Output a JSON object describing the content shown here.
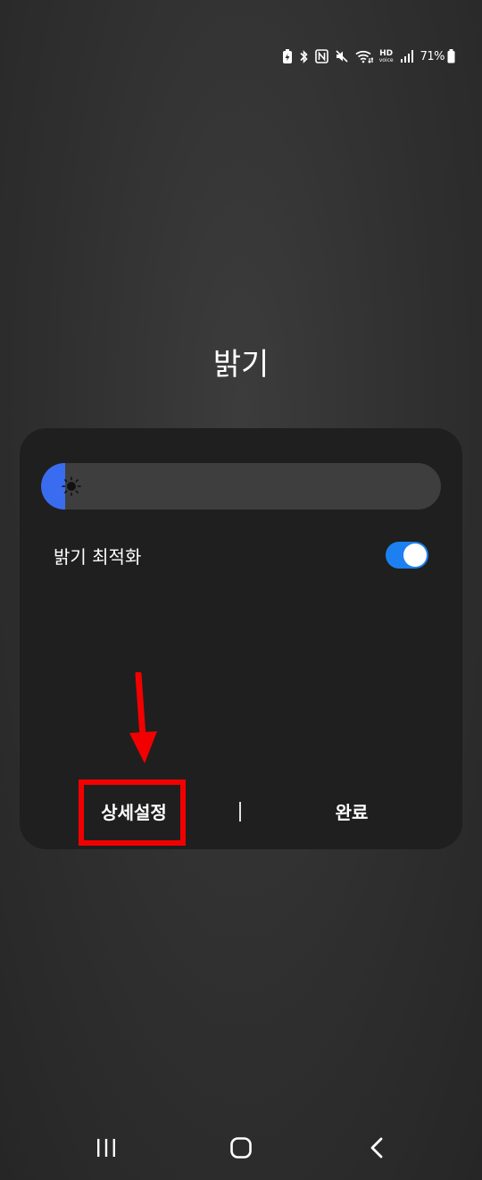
{
  "status_bar": {
    "battery_percent": "71%",
    "icons": [
      "battery-saver-icon",
      "bluetooth-icon",
      "nfc-icon",
      "mute-icon",
      "wifi-icon",
      "hd-voice-icon",
      "signal-icon",
      "battery-icon"
    ],
    "hd_label": "HD",
    "voice_label": "voice"
  },
  "title": "밝기",
  "panel": {
    "brightness_level": 0.06,
    "adaptive_label": "밝기 최적화",
    "adaptive_enabled": true,
    "detail_label": "상세설정",
    "done_label": "완료"
  },
  "colors": {
    "accent": "#3a6cf0",
    "toggle": "#1c80f0",
    "highlight": "#f20000",
    "panel_bg": "#1f1f1f"
  },
  "navbar": {
    "icons": [
      "recents-icon",
      "home-icon",
      "back-icon"
    ]
  }
}
